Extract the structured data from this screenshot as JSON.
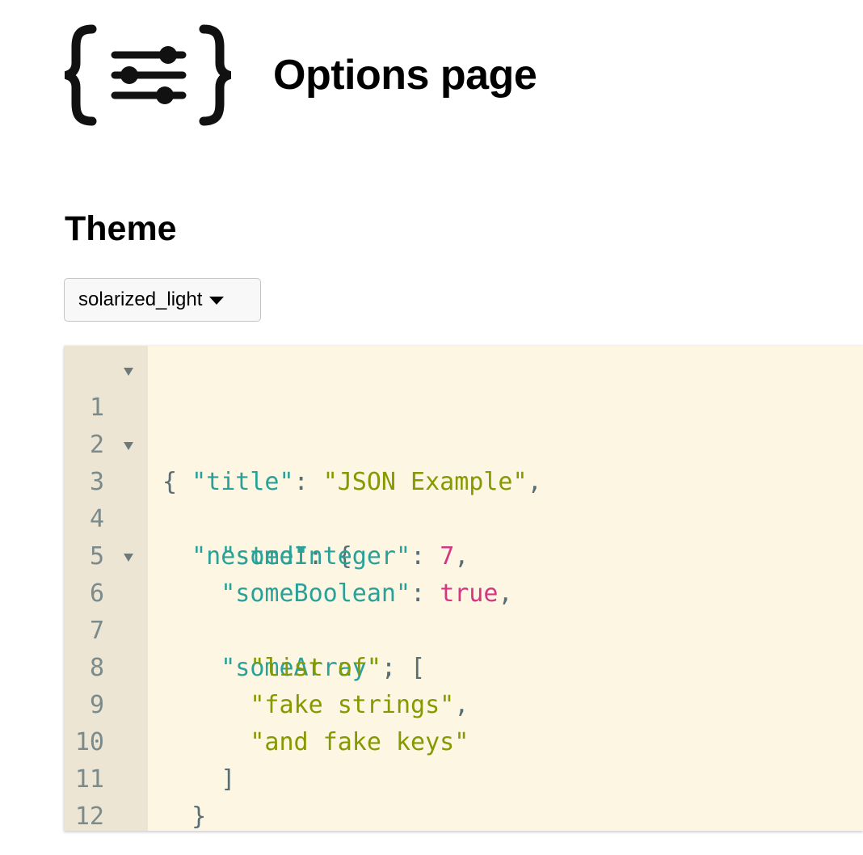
{
  "header": {
    "logo_icon": "json-options-logo-icon",
    "title": "Options page"
  },
  "theme_section": {
    "heading": "Theme",
    "select": {
      "selected": "solarized_light"
    }
  },
  "editor": {
    "background": "#fdf6e3",
    "gutter_background": "#ece5d3",
    "colors": {
      "key": "#2aa198",
      "string": "#859900",
      "number": "#d33682",
      "punctuation": "#586e75"
    },
    "lines": [
      {
        "number": "1",
        "fold": true
      },
      {
        "number": "2",
        "fold": false
      },
      {
        "number": "3",
        "fold": true
      },
      {
        "number": "4",
        "fold": false
      },
      {
        "number": "5",
        "fold": false
      },
      {
        "number": "6",
        "fold": true
      },
      {
        "number": "7",
        "fold": false
      },
      {
        "number": "8",
        "fold": false
      },
      {
        "number": "9",
        "fold": false
      },
      {
        "number": "10",
        "fold": false
      },
      {
        "number": "11",
        "fold": false
      },
      {
        "number": "12",
        "fold": false
      }
    ],
    "tokens": {
      "l1_open": "{",
      "l2_key": "\"title\"",
      "l2_colon": ": ",
      "l2_value": "\"JSON Example\"",
      "l2_comma": ",",
      "l3_key": "\"nested\"",
      "l3_colon": ": ",
      "l3_open": "{",
      "l4_key": "\"someInteger\"",
      "l4_colon": ": ",
      "l4_value": "7",
      "l4_comma": ",",
      "l5_key": "\"someBoolean\"",
      "l5_colon": ": ",
      "l5_value": "true",
      "l5_comma": ",",
      "l6_key": "\"someArray\"",
      "l6_colon": ": ",
      "l6_open": "[",
      "l7_value": "\"list of\"",
      "l7_comma": ",",
      "l8_value": "\"fake strings\"",
      "l8_comma": ",",
      "l9_value": "\"and fake keys\"",
      "l10_close": "]",
      "l11_close": "}",
      "l12_close": "}"
    }
  }
}
